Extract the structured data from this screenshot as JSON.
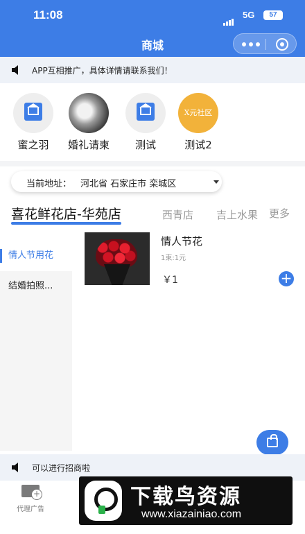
{
  "status_bar": {
    "time": "11:08",
    "network": "5G",
    "battery": "57"
  },
  "nav": {
    "title": "商城"
  },
  "notice_top": {
    "text": "APP互相推广，具体详情请联系我们！"
  },
  "shops": [
    {
      "label": "蜜之羽",
      "logo": "house-logo"
    },
    {
      "label": "婚礼请柬",
      "logo": "photo-logo"
    },
    {
      "label": "测试",
      "logo": "house-logo"
    },
    {
      "label": "测试2",
      "logo": "x-logo",
      "logo_text": "X元社区"
    }
  ],
  "address": {
    "label": "当前地址：",
    "value": "河北省 石家庄市 栾城区"
  },
  "store_tabs": {
    "active": "喜花鲜花店-华苑店",
    "tab2": "西青店",
    "tab3": "吉上水果",
    "more": "更多"
  },
  "categories": [
    {
      "label": "情人节用花",
      "active": true
    },
    {
      "label": "结婚拍照..."
    }
  ],
  "product": {
    "name": "情人节花",
    "spec": "1束:1元",
    "price": "￥1"
  },
  "notice_bottom": {
    "text": "可以进行招商啦"
  },
  "tabbar": {
    "item1": "代理广告"
  },
  "watermark": {
    "title": "下载鸟资源",
    "url": "www.xiazainiao.com"
  },
  "colors": {
    "accent": "#3d7de6",
    "watermark_bg": "#0f0f0f",
    "logo_green": "#2bb14a"
  }
}
